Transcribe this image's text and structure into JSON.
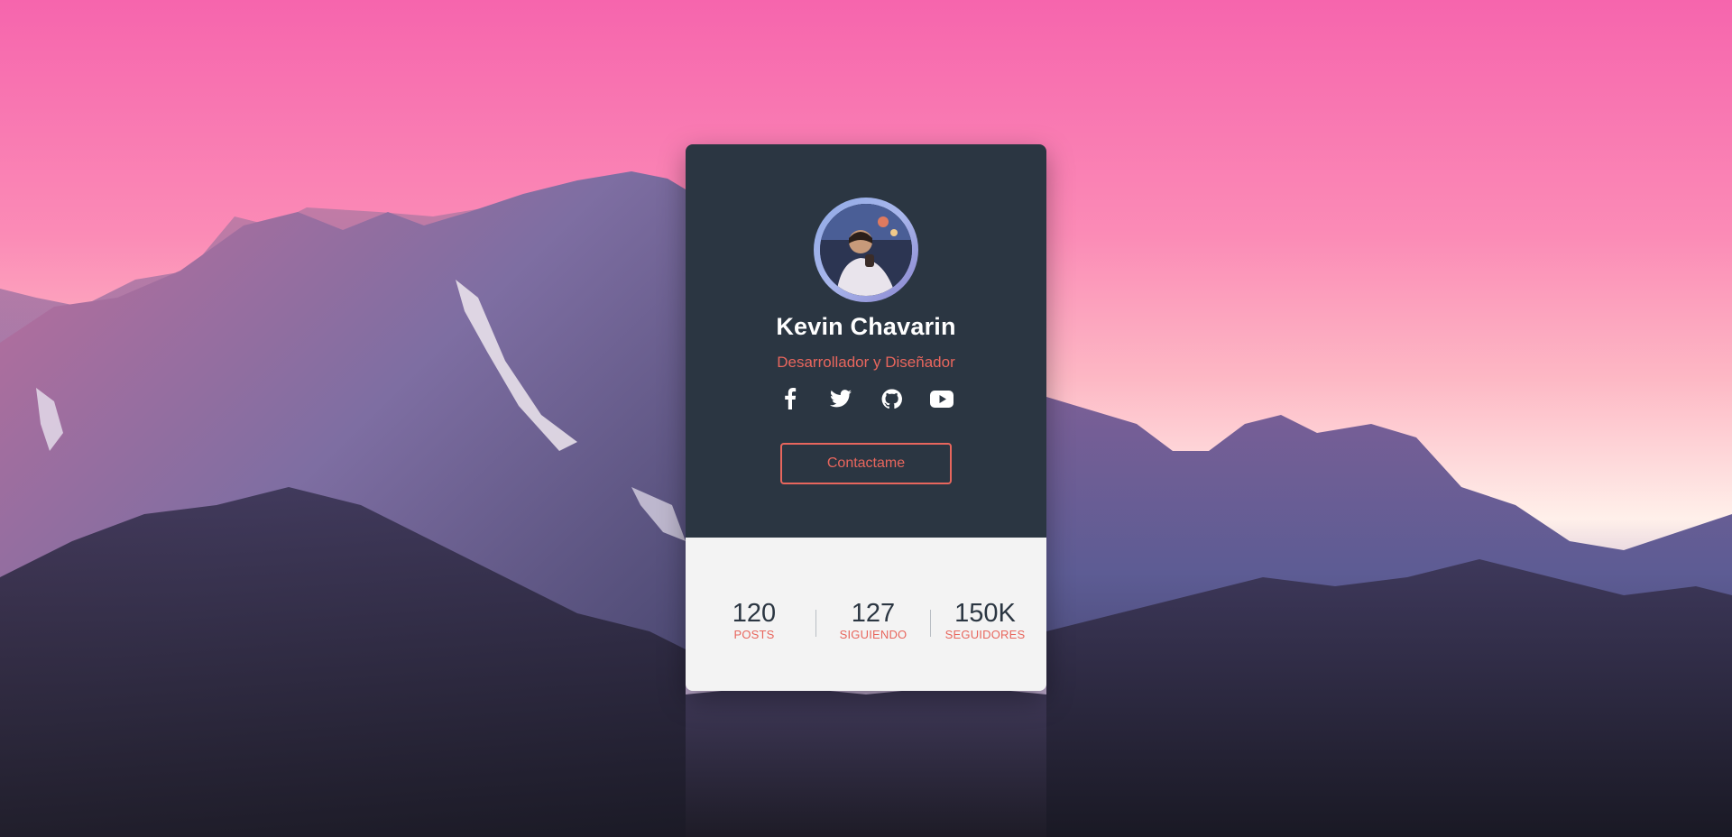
{
  "background": {
    "scene": "mountain-range-sunset",
    "sky_top_color": "#f665ad",
    "sky_horizon_color": "#fff0ea",
    "mountain_color": "#6b5f97"
  },
  "profile_card": {
    "name": "Kevin Chavarin",
    "role": "Desarrollador y Diseñador",
    "avatar_icon": "avatar-photo",
    "social_links": [
      {
        "icon": "facebook-icon"
      },
      {
        "icon": "twitter-icon"
      },
      {
        "icon": "github-icon"
      },
      {
        "icon": "youtube-icon"
      }
    ],
    "contact_button_label": "Contactame",
    "stats": [
      {
        "value": "120",
        "label": "POSTS"
      },
      {
        "value": "127",
        "label": "SIGUIENDO"
      },
      {
        "value": "150K",
        "label": "SEGUIDORES"
      }
    ]
  },
  "colors": {
    "card_dark": "#2b3642",
    "card_light": "#f3f3f3",
    "accent": "#e8665d",
    "text_light": "#ffffff"
  }
}
